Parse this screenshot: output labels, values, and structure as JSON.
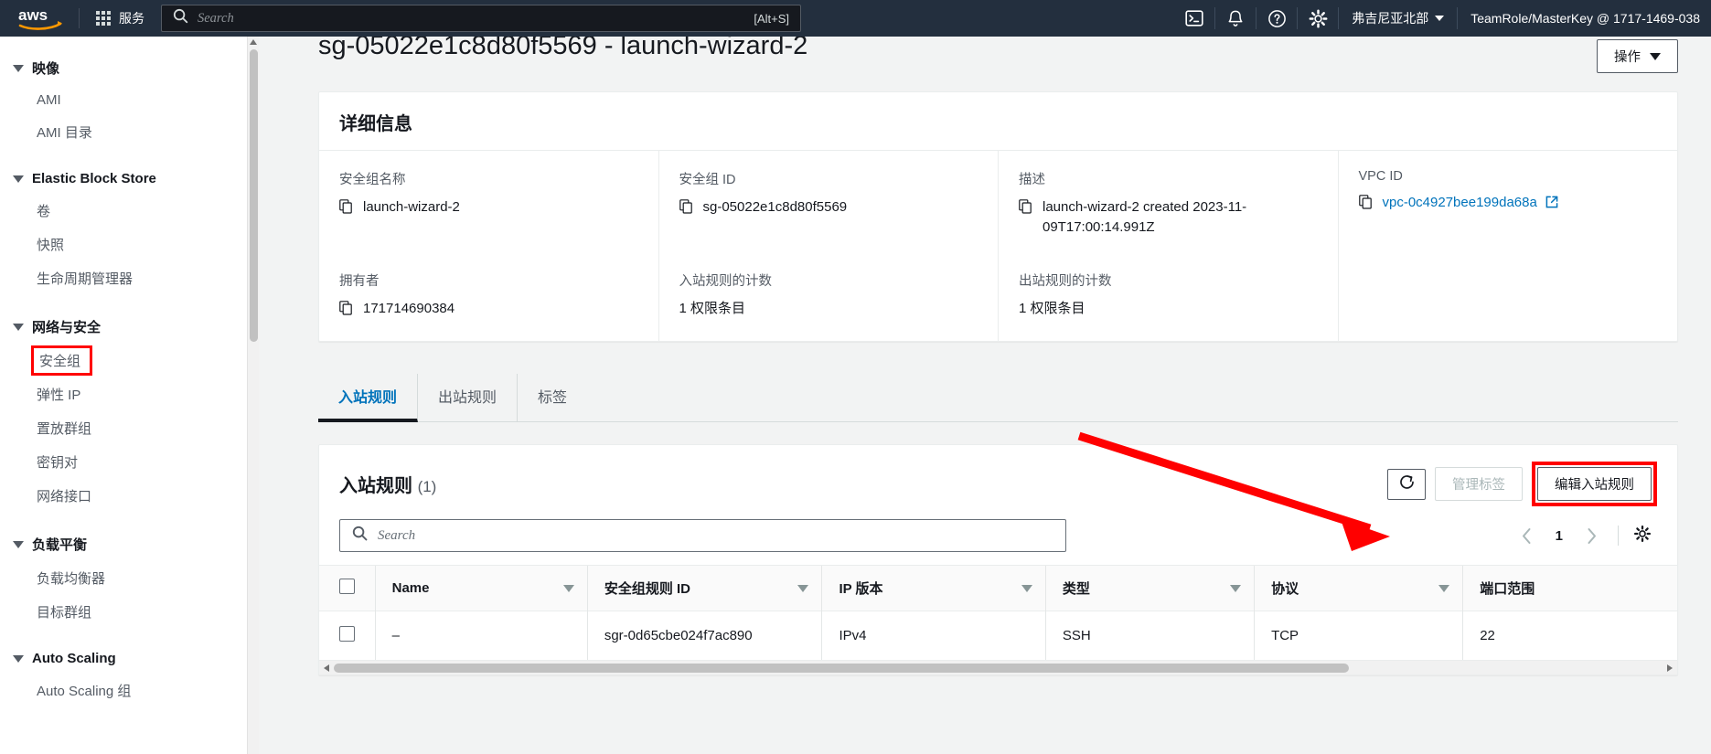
{
  "topnav": {
    "logo_alt": "aws",
    "services_label": "服务",
    "search": {
      "placeholder": "Search",
      "shortcut": "[Alt+S]",
      "value": ""
    },
    "icons": [
      {
        "name": "cloudshell-icon"
      },
      {
        "name": "notifications-bell-icon"
      },
      {
        "name": "help-question-icon"
      },
      {
        "name": "settings-gear-icon"
      }
    ],
    "region": "弗吉尼亚北部",
    "account": "TeamRole/MasterKey @ 1717-1469-038"
  },
  "sidebar": {
    "groups": [
      {
        "title": "映像",
        "items": [
          {
            "label": "AMI",
            "highlighted": false
          },
          {
            "label": "AMI 目录",
            "highlighted": false
          }
        ]
      },
      {
        "title": "Elastic Block Store",
        "items": [
          {
            "label": "卷",
            "highlighted": false
          },
          {
            "label": "快照",
            "highlighted": false
          },
          {
            "label": "生命周期管理器",
            "highlighted": false
          }
        ]
      },
      {
        "title": "网络与安全",
        "items": [
          {
            "label": "安全组",
            "highlighted": true
          },
          {
            "label": "弹性 IP",
            "highlighted": false
          },
          {
            "label": "置放群组",
            "highlighted": false
          },
          {
            "label": "密钥对",
            "highlighted": false
          },
          {
            "label": "网络接口",
            "highlighted": false
          }
        ]
      },
      {
        "title": "负载平衡",
        "items": [
          {
            "label": "负载均衡器",
            "highlighted": false
          },
          {
            "label": "目标群组",
            "highlighted": false
          }
        ]
      },
      {
        "title": "Auto Scaling",
        "items": [
          {
            "label": "Auto Scaling 组",
            "highlighted": false
          }
        ]
      }
    ]
  },
  "page": {
    "title": "sg-05022e1c8d80f5569 - launch-wizard-2",
    "actions_button": "操作"
  },
  "details": {
    "heading": "详细信息",
    "fields": [
      {
        "label": "安全组名称",
        "value": "launch-wizard-2",
        "copyable": true,
        "link": false
      },
      {
        "label": "安全组 ID",
        "value": "sg-05022e1c8d80f5569",
        "copyable": true,
        "link": false
      },
      {
        "label": "描述",
        "value": "launch-wizard-2 created 2023-11-09T17:00:14.991Z",
        "copyable": true,
        "link": false
      },
      {
        "label": "VPC ID",
        "value": "vpc-0c4927bee199da68a",
        "copyable": true,
        "link": true
      },
      {
        "label": "拥有者",
        "value": "171714690384",
        "copyable": true,
        "link": false
      },
      {
        "label": "入站规则的计数",
        "value": "1 权限条目",
        "copyable": false,
        "link": false
      },
      {
        "label": "出站规则的计数",
        "value": "1 权限条目",
        "copyable": false,
        "link": false
      }
    ]
  },
  "tabs": [
    {
      "label": "入站规则",
      "active": true
    },
    {
      "label": "出站规则",
      "active": false
    },
    {
      "label": "标签",
      "active": false
    }
  ],
  "rules_panel": {
    "title": "入站规则",
    "count": "(1)",
    "refresh_icon": "refresh-icon",
    "manage_tags_label": "管理标签",
    "manage_tags_disabled": true,
    "edit_rules_label": "编辑入站规则",
    "edit_rules_highlighted": true,
    "search": {
      "placeholder": "Search",
      "value": ""
    },
    "pagination": {
      "prev": "‹",
      "page": "1",
      "next": "›",
      "settings_icon": "gear-icon"
    },
    "columns": [
      "Name",
      "安全组规则 ID",
      "IP 版本",
      "类型",
      "协议",
      "端口范围"
    ],
    "rows": [
      {
        "selected": false,
        "name": "–",
        "rule_id": "sgr-0d65cbe024f7ac890",
        "ip_version": "IPv4",
        "type": "SSH",
        "protocol": "TCP",
        "port_range": "22"
      }
    ]
  },
  "annotations": {
    "arrow_color": "#ff0000",
    "highlight_color": "#ff0000"
  }
}
